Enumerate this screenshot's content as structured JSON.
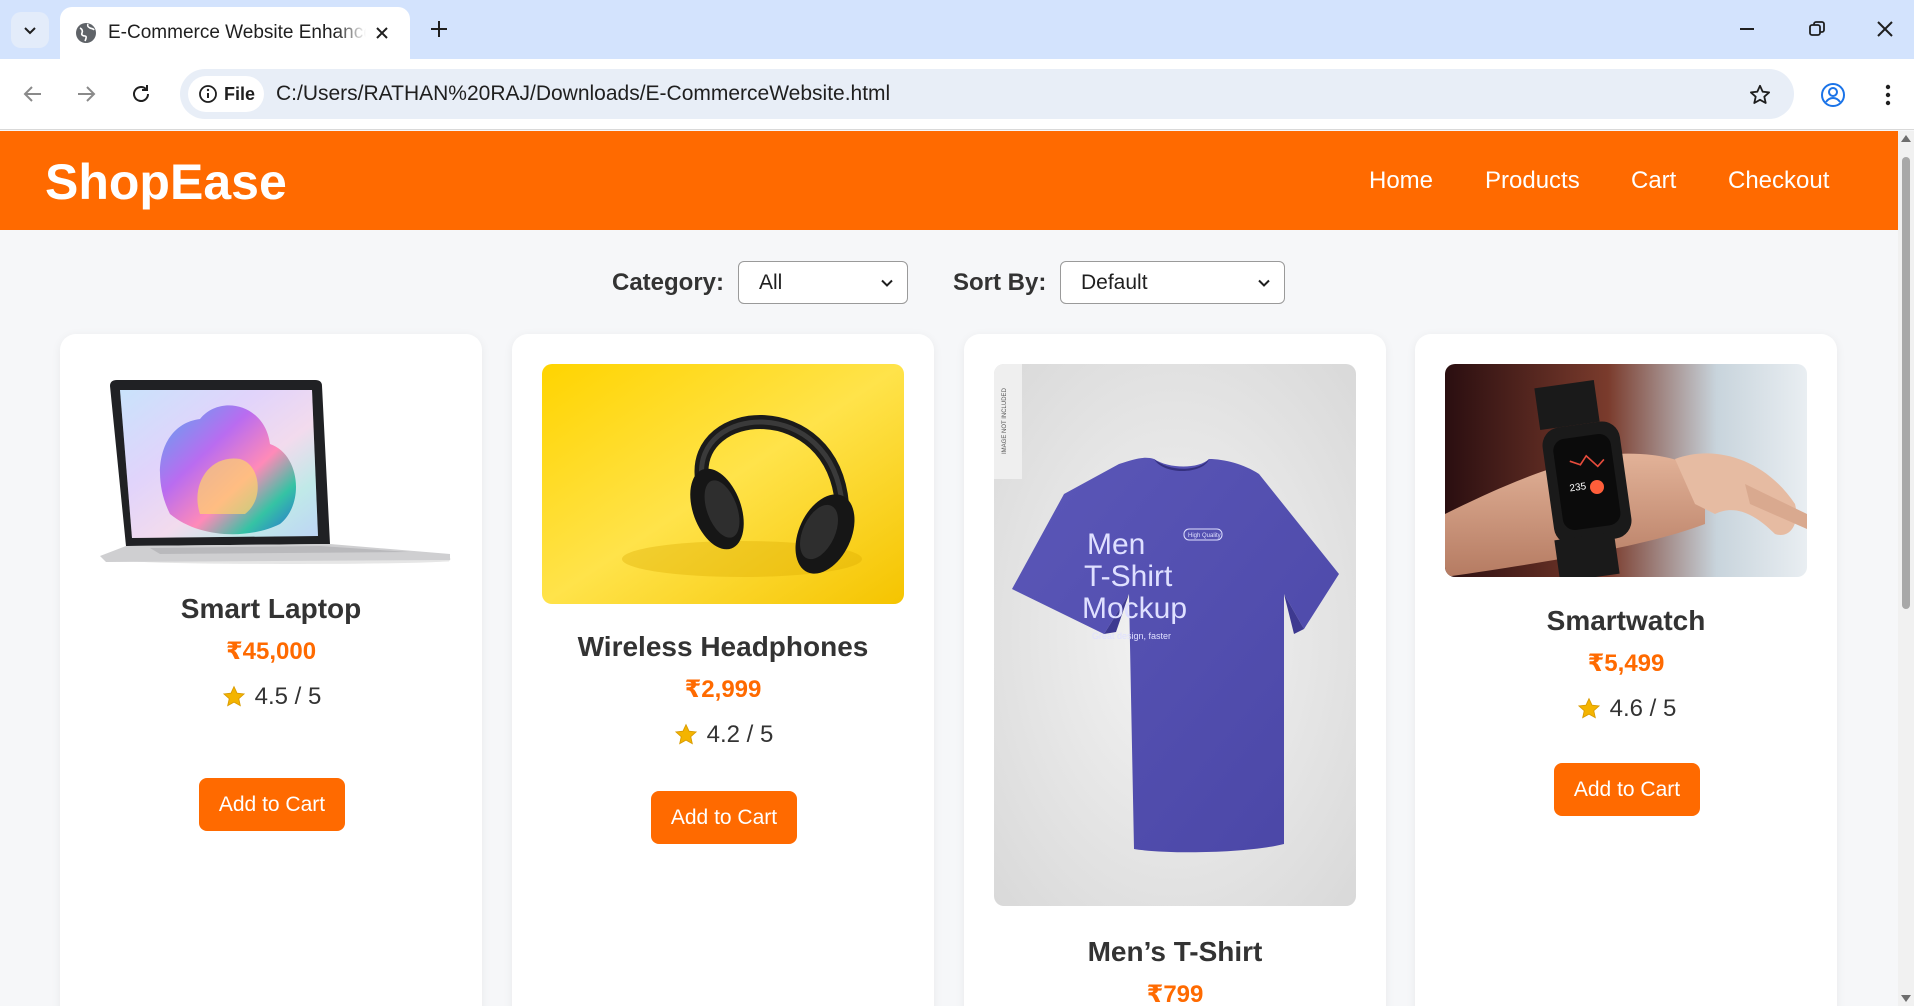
{
  "browser": {
    "tab_title": "E-Commerce Website Enhancement",
    "url_scheme_label": "File",
    "url": "C:/Users/RATHAN%20RAJ/Downloads/E-CommerceWebsite.html"
  },
  "site": {
    "logo": "ShopEase",
    "nav": [
      "Home",
      "Products",
      "Cart",
      "Checkout"
    ]
  },
  "filters": {
    "category_label": "Category:",
    "category_value": "All",
    "sort_label": "Sort By:",
    "sort_value": "Default"
  },
  "products": [
    {
      "name": "Smart Laptop",
      "price": "₹45,000",
      "rating": "4.5 / 5",
      "button": "Add to Cart"
    },
    {
      "name": "Wireless Headphones",
      "price": "₹2,999",
      "rating": "4.2 / 5",
      "button": "Add to Cart"
    },
    {
      "name": "Men’s T-Shirt",
      "price": "₹799"
    },
    {
      "name": "Smartwatch",
      "price": "₹5,499",
      "rating": "4.6 / 5",
      "button": "Add to Cart"
    }
  ],
  "tshirt_mockup_text": {
    "line1": "Men",
    "line2": "T-Shirt",
    "line3": "Mockup",
    "tagline": "Great design, faster",
    "badge": "High Quality",
    "side_note": "IMAGE NOT INCLUDED"
  },
  "watch_screen_number": "235",
  "colors": {
    "brand_orange": "#ff6a00",
    "tab_strip": "#d3e3fd",
    "omnibox": "#e8eef7"
  }
}
